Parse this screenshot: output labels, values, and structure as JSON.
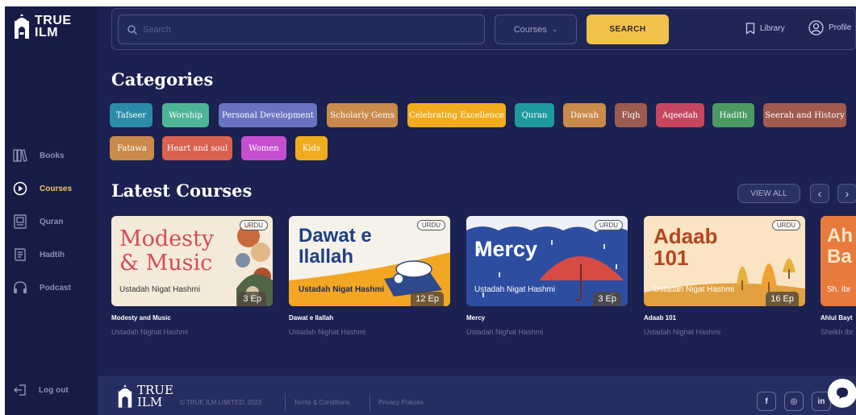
{
  "brand": {
    "line1": "TRUE",
    "line2": "ILM"
  },
  "sidebar": {
    "items": [
      {
        "label": "Books",
        "icon": "books-icon"
      },
      {
        "label": "Courses",
        "icon": "play-circle-icon",
        "active": true
      },
      {
        "label": "Quran",
        "icon": "quran-icon"
      },
      {
        "label": "Hadtih",
        "icon": "book-icon"
      },
      {
        "label": "Podcast",
        "icon": "headphones-icon"
      }
    ],
    "logout": "Log out"
  },
  "topbar": {
    "search_placeholder": "Search",
    "select_value": "Courses",
    "search_button": "SEARCH",
    "library": "Library",
    "profile": "Profile"
  },
  "categories": {
    "title": "Categories",
    "chips": [
      {
        "label": "Tafseer",
        "color": "#2c8ba8"
      },
      {
        "label": "Worship",
        "color": "#4fb496"
      },
      {
        "label": "Personal Development",
        "color": "#6a73c2"
      },
      {
        "label": "Scholarly Gems",
        "color": "#c98a4b"
      },
      {
        "label": "Celebrating Excellence",
        "color": "#f0ac1c"
      },
      {
        "label": "Quran",
        "color": "#1e9a9e"
      },
      {
        "label": "Dawah",
        "color": "#c98a4b"
      },
      {
        "label": "Fiqh",
        "color": "#9b5b4e"
      },
      {
        "label": "Aqeedah",
        "color": "#c7465f"
      },
      {
        "label": "Hadith",
        "color": "#4b9a63"
      },
      {
        "label": "Seerah and History",
        "color": "#a05a4e"
      },
      {
        "label": "Fatawa",
        "color": "#c98a4b"
      },
      {
        "label": "Heart and soul",
        "color": "#d9614f"
      },
      {
        "label": "Women",
        "color": "#c64fd0"
      },
      {
        "label": "Kids",
        "color": "#f0ac1c"
      }
    ]
  },
  "latest": {
    "title": "Latest Courses",
    "view_all": "VIEW ALL",
    "prev": "‹",
    "next": "›",
    "courses": [
      {
        "cover_title": "Modesty & Music",
        "cover_author": "Ustadah Nigat Hashmi",
        "badge": "URDU",
        "episodes": "3 Ep",
        "title": "Modesty and Music",
        "author": "Ustadah Nighat Hashmi"
      },
      {
        "cover_title": "Dawat e Ilallah",
        "cover_author": "Ustadah Nigat Hashmi",
        "badge": "URDU",
        "episodes": "12 Ep",
        "title": "Dawat e Ilallah",
        "author": "Ustadah Nighat Hashmi"
      },
      {
        "cover_title": "Mercy",
        "cover_author": "Ustadah Nigat Hashmi",
        "badge": "URDU",
        "episodes": "3 Ep",
        "title": "Mercy",
        "author": "Ustadah Nighat Hashmi"
      },
      {
        "cover_title": "Adaab 101",
        "cover_author": "Ustadah Nigat Hashmi",
        "badge": "URDU",
        "episodes": "16 Ep",
        "title": "Adaab 101",
        "author": "Ustadah Nighat Hashmi"
      },
      {
        "cover_title": "Ah Ba",
        "cover_author": "Sh. Ibr",
        "title": "Ahlul Bayt",
        "author": "Sheikh Ibr"
      }
    ]
  },
  "footer": {
    "copyright": "© TRUE ILM LIMITED, 2023",
    "terms": "Terms & Conditions",
    "privacy": "Privacy Policies",
    "social": [
      "f",
      "◎",
      "in"
    ]
  }
}
